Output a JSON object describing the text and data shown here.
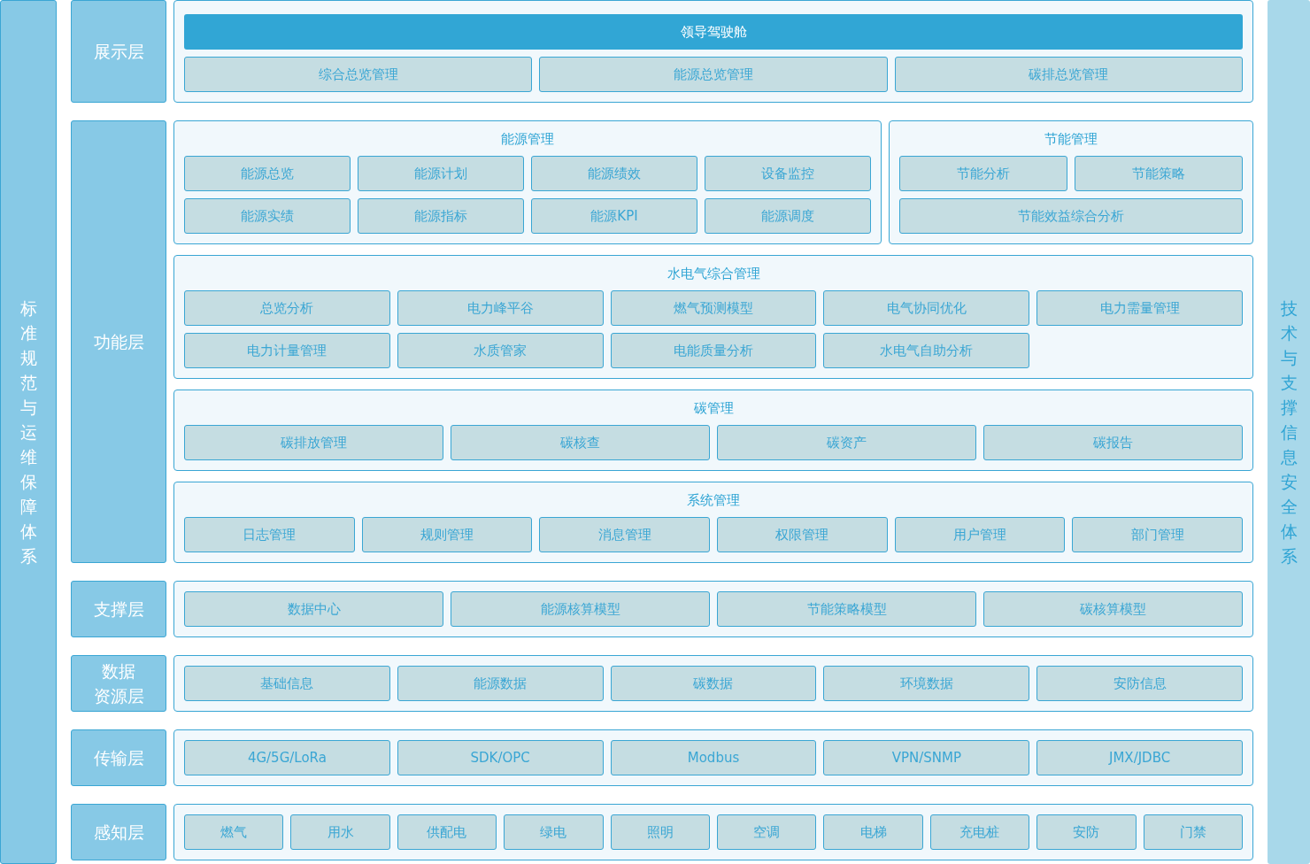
{
  "left_bar": {
    "label": "标准规范与运维保障体系"
  },
  "right_bar": {
    "label": "技术与支撑信息安全体系"
  },
  "layers": [
    {
      "label": [
        "展示层"
      ],
      "sections": [
        [
          {
            "banner": "领导驾驶舱",
            "rows": [
              [
                "综合总览管理",
                "能源总览管理",
                "碳排总览管理"
              ]
            ]
          }
        ]
      ]
    },
    {
      "label": [
        "功能层"
      ],
      "sections": [
        [
          {
            "title": "能源管理",
            "rows": [
              [
                "能源总览",
                "能源计划",
                "能源绩效",
                "设备监控"
              ],
              [
                "能源实绩",
                "能源指标",
                "能源KPI",
                "能源调度"
              ]
            ]
          },
          {
            "title": "节能管理",
            "rows": [
              [
                "节能分析",
                "节能策略"
              ],
              [
                "节能效益综合分析"
              ]
            ]
          }
        ],
        [
          {
            "title": "水电气综合管理",
            "rows": [
              [
                "总览分析",
                "电力峰平谷",
                "燃气预测模型",
                "电气协同优化",
                "电力需量管理"
              ],
              [
                "电力计量管理",
                "水质管家",
                "电能质量分析",
                "水电气自助分析"
              ]
            ]
          }
        ],
        [
          {
            "title": "碳管理",
            "rows": [
              [
                "碳排放管理",
                "碳核查",
                "碳资产",
                "碳报告"
              ]
            ]
          }
        ],
        [
          {
            "title": "系统管理",
            "rows": [
              [
                "日志管理",
                "规则管理",
                "消息管理",
                "权限管理",
                "用户管理",
                "部门管理"
              ]
            ]
          }
        ]
      ]
    },
    {
      "label": [
        "支撑层"
      ],
      "sections": [
        [
          {
            "rows": [
              [
                "数据中心",
                "能源核算模型",
                "节能策略模型",
                "碳核算模型"
              ]
            ]
          }
        ]
      ]
    },
    {
      "label": [
        "数据",
        "资源层"
      ],
      "sections": [
        [
          {
            "rows": [
              [
                "基础信息",
                "能源数据",
                "碳数据",
                "环境数据",
                "安防信息"
              ]
            ]
          }
        ]
      ]
    },
    {
      "label": [
        "传输层"
      ],
      "sections": [
        [
          {
            "rows": [
              [
                "4G/5G/LoRa",
                "SDK/OPC",
                "Modbus",
                "VPN/SNMP",
                "JMX/JDBC"
              ]
            ]
          }
        ]
      ]
    },
    {
      "label": [
        "感知层"
      ],
      "sections": [
        [
          {
            "rows": [
              [
                "燃气",
                "用水",
                "供配电",
                "绿电",
                "照明",
                "空调",
                "电梯",
                "充电桩",
                "安防",
                "门禁"
              ]
            ]
          }
        ]
      ]
    }
  ]
}
